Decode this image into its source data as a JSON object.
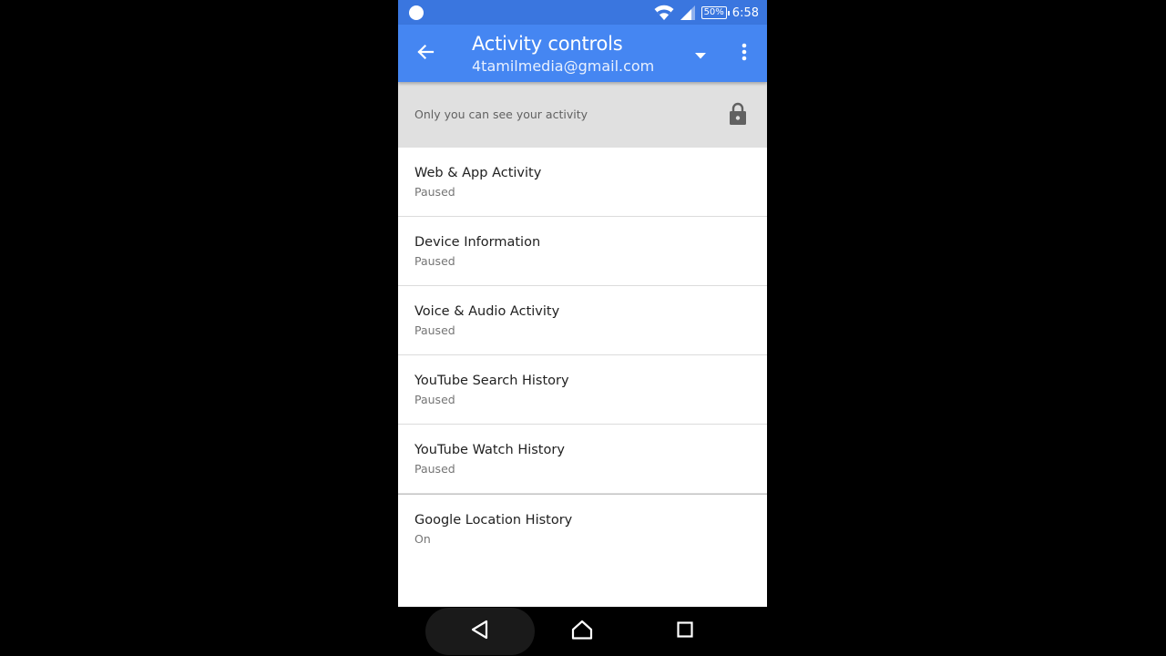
{
  "status_bar": {
    "battery": "50%",
    "time": "6:58"
  },
  "app_bar": {
    "title": "Activity controls",
    "account": "4tamilmedia@gmail.com",
    "back_icon": "arrow-back-icon",
    "dropdown_icon": "caret-down-icon",
    "overflow_icon": "more-vert-icon"
  },
  "privacy": {
    "text": "Only you can see your activity",
    "icon": "lock-icon"
  },
  "activities": [
    {
      "label": "Web & App Activity",
      "status": "Paused"
    },
    {
      "label": "Device Information",
      "status": "Paused"
    },
    {
      "label": "Voice & Audio Activity",
      "status": "Paused"
    },
    {
      "label": "YouTube Search History",
      "status": "Paused"
    },
    {
      "label": "YouTube Watch History",
      "status": "Paused"
    },
    {
      "label": "Google Location History",
      "status": "On"
    }
  ],
  "colors": {
    "app_bar": "#4586f2",
    "status_bar": "#3a76df",
    "banner": "#e0e0e0"
  }
}
